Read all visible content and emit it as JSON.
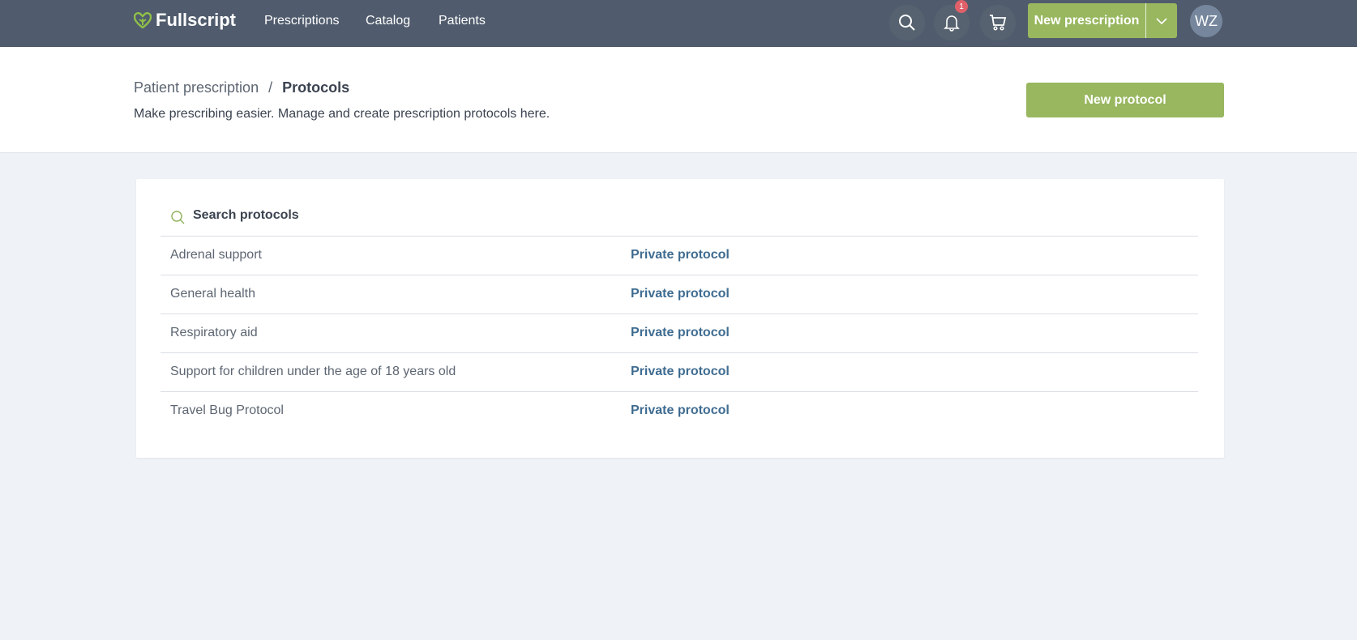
{
  "nav": {
    "brand": "Fullscript",
    "links": [
      "Prescriptions",
      "Catalog",
      "Patients"
    ],
    "notification_count": "1",
    "new_prescription": "New prescription",
    "avatar": "WZ"
  },
  "header": {
    "breadcrumb_parent": "Patient prescription",
    "breadcrumb_sep": "/",
    "breadcrumb_current": "Protocols",
    "subtitle": "Make prescribing easier. Manage and create prescription protocols here.",
    "new_protocol": "New protocol"
  },
  "search": {
    "placeholder": "Search protocols"
  },
  "protocols": [
    {
      "name": "Adrenal support",
      "type": "Private protocol"
    },
    {
      "name": "General health",
      "type": "Private protocol"
    },
    {
      "name": "Respiratory aid",
      "type": "Private protocol"
    },
    {
      "name": "Support for children under the age of 18 years old",
      "type": "Private protocol"
    },
    {
      "name": "Travel Bug Protocol",
      "type": "Private protocol"
    }
  ],
  "colors": {
    "nav": "#505c6d",
    "accent": "#98b75f",
    "link": "#3f6c91"
  }
}
